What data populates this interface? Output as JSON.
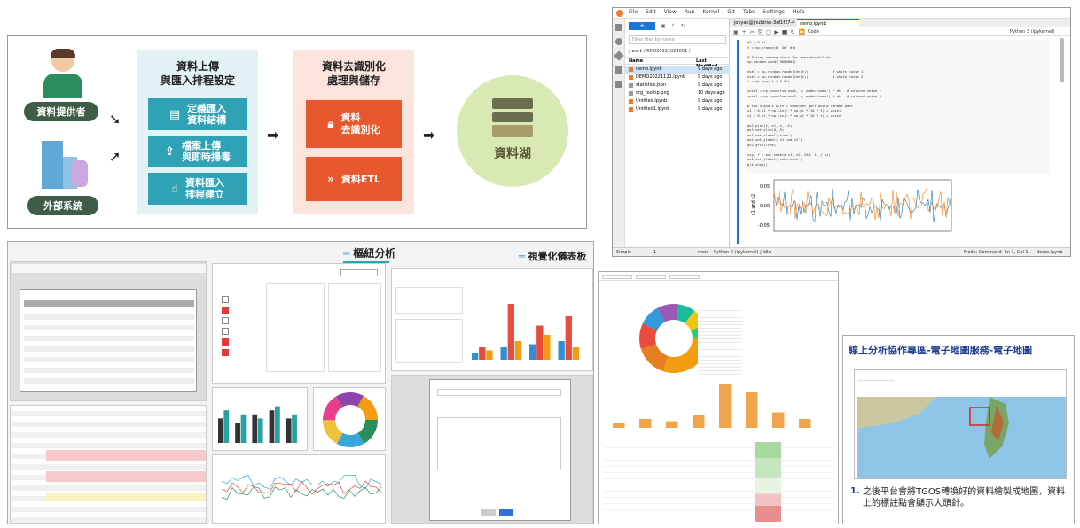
{
  "flow": {
    "provider_label": "資料提供者",
    "external_label": "外部系統",
    "upload_title": "資料上傳\n與匯入排程設定",
    "upload_items": [
      "定義匯入\n資料結構",
      "檔案上傳\n與即時掃毒",
      "資料匯入\n排程建立"
    ],
    "deid_title": "資料去識別化\n處理與儲存",
    "deid_items": [
      "資料\n去識別化",
      "資料ETL"
    ],
    "lake_label": "資料湖"
  },
  "jupyter": {
    "menu": [
      "File",
      "Edit",
      "View",
      "Run",
      "Kernel",
      "Git",
      "Tabs",
      "Settings",
      "Help"
    ],
    "filter_placeholder": "Filter files by name",
    "path": "/ work / RM020221024001 /",
    "col_name": "Name",
    "col_modified": "Last Modified",
    "files": [
      {
        "name": "demo.ipynb",
        "mod": "9 days ago"
      },
      {
        "name": "DEMO20221121.ipynb",
        "mod": "9 days ago"
      },
      {
        "name": "statistics.json",
        "mod": "9 days ago"
      },
      {
        "name": "org_tooltip.png",
        "mod": "10 days ago"
      },
      {
        "name": "Untitled.ipynb",
        "mod": "9 days ago"
      },
      {
        "name": "Untitled1.ipynb",
        "mod": "9 days ago"
      }
    ],
    "tabs": [
      "jovyan@jhubtrial-3ef1f37-4",
      "demo.ipynb"
    ],
    "kernel": "Python 3 (ipykernel)",
    "code_label": "Code",
    "code": [
      "dt = 0.01",
      "t = np.arange(0, 30, dt)",
      "",
      "# Fixing random state for reproducibility",
      "np.random.seed(19680801)",
      "",
      "nse1 = np.random.randn(len(t))            # white noise 1",
      "nse2 = np.random.randn(len(t))            # white noise 2",
      "r = np.exp(-t / 0.05)",
      "",
      "cnse1 = np.convolve(nse1, r, mode='same') * dt   # colored noise 1",
      "cnse2 = np.convolve(nse2, r, mode='same') * dt   # colored noise 2",
      "",
      "# two signals with a coherent part and a random part",
      "s1 = 0.01 * np.sin(2 * np.pi * 10 * t) + cnse1",
      "s2 = 0.01 * np.sin(2 * np.pi * 10 * t) + cnse2",
      "",
      "ax1.plot(t, s1, t, s2)",
      "ax1.set_xlim(0, 5)",
      "ax1.set_xlabel('time')",
      "ax1.set_ylabel('s1 and s2')",
      "ax1.grid(True)",
      "",
      "cxy, f = ax2.cohere(s1, s2, 256, 1. / dt)",
      "ax2.set_ylabel('coherence')",
      "plt.show()"
    ],
    "plot_ylabel": "s1 and s2",
    "plot_ticks": [
      "0.05",
      "0.00",
      "-0.05"
    ],
    "status_left": "Simple",
    "status_nums": "1",
    "status_main": "main",
    "status_kernel": "Python 3 (ipykernel) | Idle",
    "status_mode": "Mode: Command",
    "status_pos": "Ln 1, Col 1",
    "status_file": "demo.ipynb"
  },
  "analysis": {
    "title1": "樞紐分析",
    "title2": "視覺化儀表板"
  },
  "map": {
    "title": "線上分析協作專區-電子地圖服務-電子地圖",
    "caption_num": "1.",
    "caption": "之後平台會將TGOS轉換好的資料繪製成地圖，資料上的標註點會顯示大頭針。"
  },
  "colors": {
    "teal": "#2fa3b5",
    "red": "#e8572e",
    "green_circle": "#d9e9b4",
    "jup_blue": "#1976d2"
  }
}
